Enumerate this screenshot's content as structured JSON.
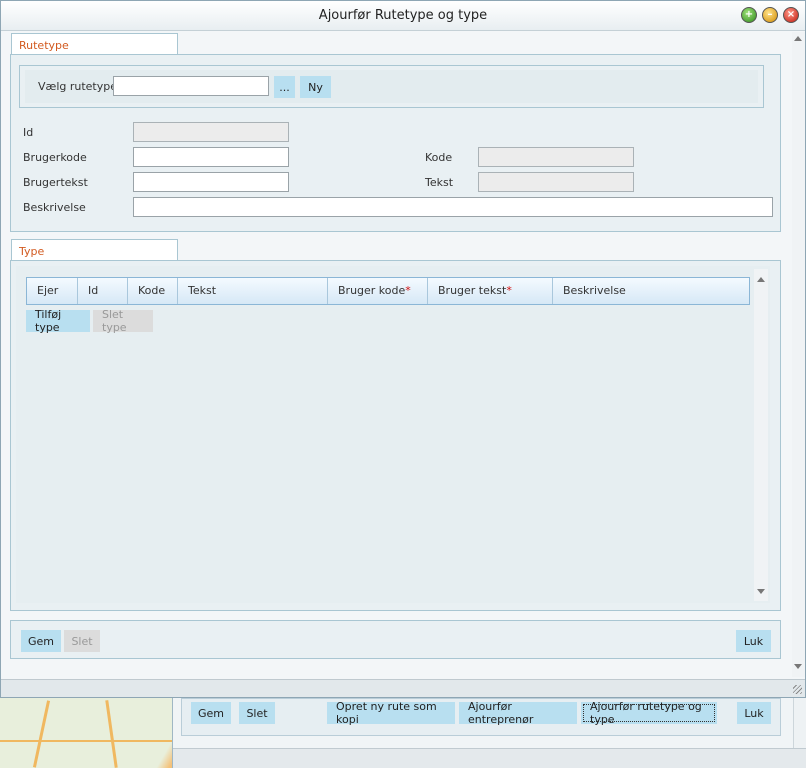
{
  "window": {
    "title": "Ajourfør Rutetype og type"
  },
  "rutetype": {
    "tab_label": "Rutetype",
    "select_label": "Vælg rutetype:",
    "select_value": "",
    "browse_label": "...",
    "new_label": "Ny",
    "id_label": "Id",
    "id_value": "",
    "brugerkode_label": "Brugerkode",
    "brugerkode_value": "",
    "brugertekst_label": "Brugertekst",
    "brugertekst_value": "",
    "beskrivelse_label": "Beskrivelse",
    "beskrivelse_value": "",
    "kode_label": "Kode",
    "kode_value": "",
    "tekst_label": "Tekst",
    "tekst_value": ""
  },
  "type": {
    "tab_label": "Type",
    "columns": [
      "Ejer",
      "Id",
      "Kode",
      "Tekst",
      "Bruger kode",
      "Bruger tekst",
      "Beskrivelse"
    ],
    "required_marker": "*",
    "add_label": "Tilføj type",
    "delete_label": "Slet type"
  },
  "footer": {
    "save_label": "Gem",
    "delete_label": "Slet",
    "close_label": "Luk"
  },
  "background_window": {
    "save_label": "Gem",
    "delete_label": "Slet",
    "copy_label": "Opret ny rute som kopi",
    "contractor_label": "Ajourfør entreprenør",
    "rutetype_label": "Ajourfør rutetype og type",
    "close_label": "Luk"
  }
}
